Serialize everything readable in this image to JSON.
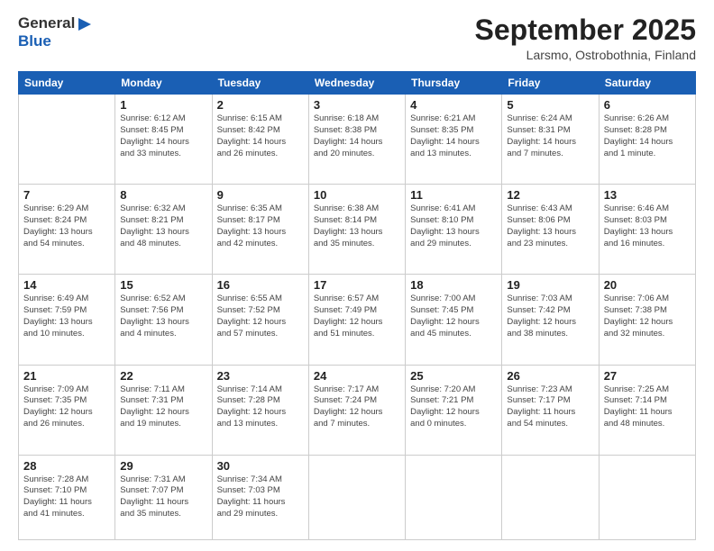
{
  "logo": {
    "general": "General",
    "blue": "Blue"
  },
  "title": "September 2025",
  "location": "Larsmo, Ostrobothnia, Finland",
  "weekdays": [
    "Sunday",
    "Monday",
    "Tuesday",
    "Wednesday",
    "Thursday",
    "Friday",
    "Saturday"
  ],
  "weeks": [
    [
      {
        "day": "",
        "info": ""
      },
      {
        "day": "1",
        "info": "Sunrise: 6:12 AM\nSunset: 8:45 PM\nDaylight: 14 hours\nand 33 minutes."
      },
      {
        "day": "2",
        "info": "Sunrise: 6:15 AM\nSunset: 8:42 PM\nDaylight: 14 hours\nand 26 minutes."
      },
      {
        "day": "3",
        "info": "Sunrise: 6:18 AM\nSunset: 8:38 PM\nDaylight: 14 hours\nand 20 minutes."
      },
      {
        "day": "4",
        "info": "Sunrise: 6:21 AM\nSunset: 8:35 PM\nDaylight: 14 hours\nand 13 minutes."
      },
      {
        "day": "5",
        "info": "Sunrise: 6:24 AM\nSunset: 8:31 PM\nDaylight: 14 hours\nand 7 minutes."
      },
      {
        "day": "6",
        "info": "Sunrise: 6:26 AM\nSunset: 8:28 PM\nDaylight: 14 hours\nand 1 minute."
      }
    ],
    [
      {
        "day": "7",
        "info": "Sunrise: 6:29 AM\nSunset: 8:24 PM\nDaylight: 13 hours\nand 54 minutes."
      },
      {
        "day": "8",
        "info": "Sunrise: 6:32 AM\nSunset: 8:21 PM\nDaylight: 13 hours\nand 48 minutes."
      },
      {
        "day": "9",
        "info": "Sunrise: 6:35 AM\nSunset: 8:17 PM\nDaylight: 13 hours\nand 42 minutes."
      },
      {
        "day": "10",
        "info": "Sunrise: 6:38 AM\nSunset: 8:14 PM\nDaylight: 13 hours\nand 35 minutes."
      },
      {
        "day": "11",
        "info": "Sunrise: 6:41 AM\nSunset: 8:10 PM\nDaylight: 13 hours\nand 29 minutes."
      },
      {
        "day": "12",
        "info": "Sunrise: 6:43 AM\nSunset: 8:06 PM\nDaylight: 13 hours\nand 23 minutes."
      },
      {
        "day": "13",
        "info": "Sunrise: 6:46 AM\nSunset: 8:03 PM\nDaylight: 13 hours\nand 16 minutes."
      }
    ],
    [
      {
        "day": "14",
        "info": "Sunrise: 6:49 AM\nSunset: 7:59 PM\nDaylight: 13 hours\nand 10 minutes."
      },
      {
        "day": "15",
        "info": "Sunrise: 6:52 AM\nSunset: 7:56 PM\nDaylight: 13 hours\nand 4 minutes."
      },
      {
        "day": "16",
        "info": "Sunrise: 6:55 AM\nSunset: 7:52 PM\nDaylight: 12 hours\nand 57 minutes."
      },
      {
        "day": "17",
        "info": "Sunrise: 6:57 AM\nSunset: 7:49 PM\nDaylight: 12 hours\nand 51 minutes."
      },
      {
        "day": "18",
        "info": "Sunrise: 7:00 AM\nSunset: 7:45 PM\nDaylight: 12 hours\nand 45 minutes."
      },
      {
        "day": "19",
        "info": "Sunrise: 7:03 AM\nSunset: 7:42 PM\nDaylight: 12 hours\nand 38 minutes."
      },
      {
        "day": "20",
        "info": "Sunrise: 7:06 AM\nSunset: 7:38 PM\nDaylight: 12 hours\nand 32 minutes."
      }
    ],
    [
      {
        "day": "21",
        "info": "Sunrise: 7:09 AM\nSunset: 7:35 PM\nDaylight: 12 hours\nand 26 minutes."
      },
      {
        "day": "22",
        "info": "Sunrise: 7:11 AM\nSunset: 7:31 PM\nDaylight: 12 hours\nand 19 minutes."
      },
      {
        "day": "23",
        "info": "Sunrise: 7:14 AM\nSunset: 7:28 PM\nDaylight: 12 hours\nand 13 minutes."
      },
      {
        "day": "24",
        "info": "Sunrise: 7:17 AM\nSunset: 7:24 PM\nDaylight: 12 hours\nand 7 minutes."
      },
      {
        "day": "25",
        "info": "Sunrise: 7:20 AM\nSunset: 7:21 PM\nDaylight: 12 hours\nand 0 minutes."
      },
      {
        "day": "26",
        "info": "Sunrise: 7:23 AM\nSunset: 7:17 PM\nDaylight: 11 hours\nand 54 minutes."
      },
      {
        "day": "27",
        "info": "Sunrise: 7:25 AM\nSunset: 7:14 PM\nDaylight: 11 hours\nand 48 minutes."
      }
    ],
    [
      {
        "day": "28",
        "info": "Sunrise: 7:28 AM\nSunset: 7:10 PM\nDaylight: 11 hours\nand 41 minutes."
      },
      {
        "day": "29",
        "info": "Sunrise: 7:31 AM\nSunset: 7:07 PM\nDaylight: 11 hours\nand 35 minutes."
      },
      {
        "day": "30",
        "info": "Sunrise: 7:34 AM\nSunset: 7:03 PM\nDaylight: 11 hours\nand 29 minutes."
      },
      {
        "day": "",
        "info": ""
      },
      {
        "day": "",
        "info": ""
      },
      {
        "day": "",
        "info": ""
      },
      {
        "day": "",
        "info": ""
      }
    ]
  ]
}
